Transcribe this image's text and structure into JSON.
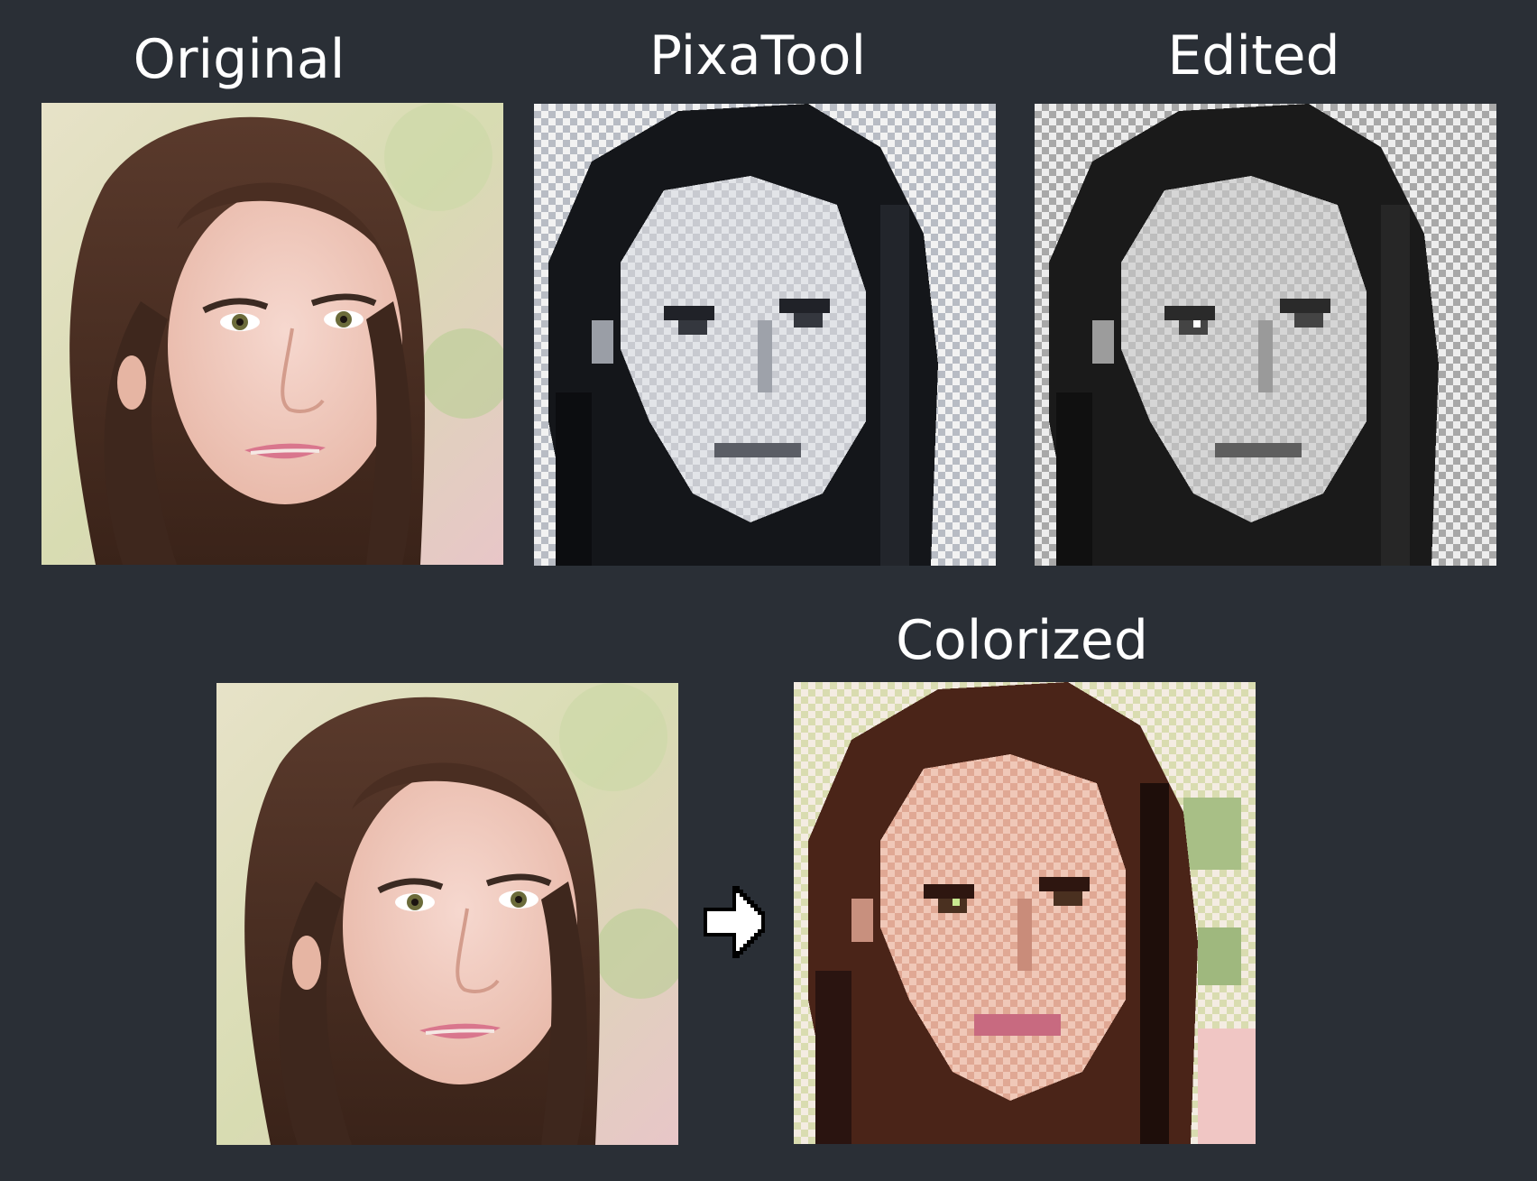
{
  "labels": {
    "original": "Original",
    "pixatool": "PixaTool",
    "edited": "Edited",
    "colorized": "Colorized"
  },
  "icons": {
    "arrow": "right-arrow-icon"
  },
  "colors": {
    "background": "#2a2f36",
    "label_text": "#ffffff"
  }
}
